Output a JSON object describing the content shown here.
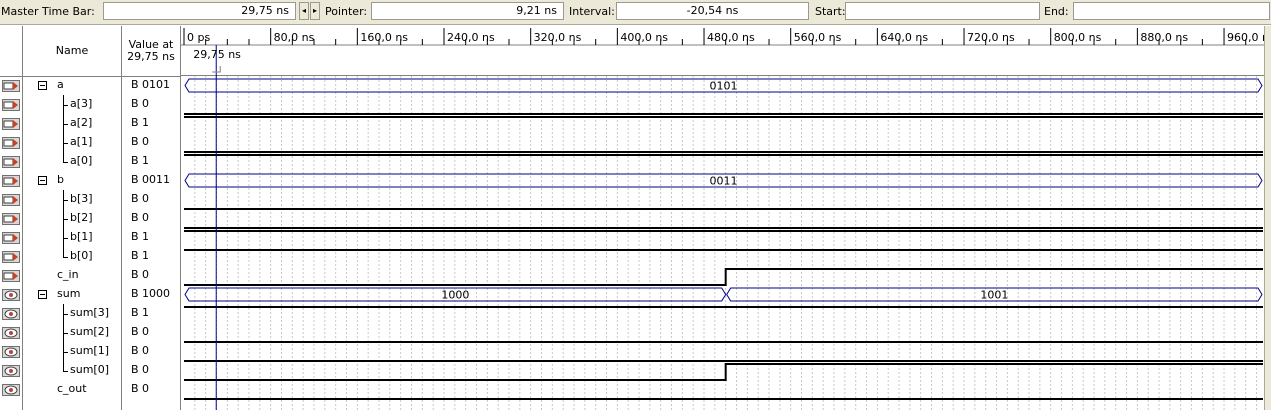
{
  "toolbar": {
    "master_time_bar_label": "Master Time Bar:",
    "master_time_bar_value": "29,75 ns",
    "pointer_label": "Pointer:",
    "pointer_value": "9,21 ns",
    "interval_label": "Interval:",
    "interval_value": "-20,54 ns",
    "start_label": "Start:",
    "start_value": "",
    "end_label": "End:",
    "end_value": "",
    "nav_left": "◂",
    "nav_right": "▸"
  },
  "columns": {
    "name_header": "Name",
    "value_header_line1": "Value at",
    "value_header_line2": "29,75 ns"
  },
  "timeline": {
    "ticks": [
      "0 ps",
      "80,0 ns",
      "160,0 ns",
      "240,0 ns",
      "320,0 ns",
      "400,0 ns",
      "480,0 ns",
      "560,0 ns",
      "640,0 ns",
      "720,0 ns",
      "800,0 ns",
      "880,0 ns",
      "960,0 ns"
    ],
    "cursor_label": "29,75 ns",
    "cursor_time_ns": 29.75,
    "ns_per_tick": 80
  },
  "signals": [
    {
      "name": "a",
      "value": "B 0101",
      "type": "input",
      "bus": true,
      "expanded": true,
      "level": 0,
      "segments": [
        {
          "from": 0,
          "to": 1000,
          "label": "0101"
        }
      ]
    },
    {
      "name": "a[3]",
      "value": "B 0",
      "type": "input",
      "level": 1,
      "tree": "mid",
      "wave": [
        [
          0,
          0
        ]
      ]
    },
    {
      "name": "a[2]",
      "value": "B 1",
      "type": "input",
      "level": 1,
      "tree": "mid",
      "wave": [
        [
          0,
          1
        ]
      ]
    },
    {
      "name": "a[1]",
      "value": "B 0",
      "type": "input",
      "level": 1,
      "tree": "mid",
      "wave": [
        [
          0,
          0
        ]
      ]
    },
    {
      "name": "a[0]",
      "value": "B 1",
      "type": "input",
      "level": 1,
      "tree": "last",
      "wave": [
        [
          0,
          1
        ]
      ]
    },
    {
      "name": "b",
      "value": "B 0011",
      "type": "input",
      "bus": true,
      "expanded": true,
      "level": 0,
      "segments": [
        {
          "from": 0,
          "to": 1000,
          "label": "0011"
        }
      ]
    },
    {
      "name": "b[3]",
      "value": "B 0",
      "type": "input",
      "level": 1,
      "tree": "mid",
      "wave": [
        [
          0,
          0
        ]
      ]
    },
    {
      "name": "b[2]",
      "value": "B 0",
      "type": "input",
      "level": 1,
      "tree": "mid",
      "wave": [
        [
          0,
          0
        ]
      ]
    },
    {
      "name": "b[1]",
      "value": "B 1",
      "type": "input",
      "level": 1,
      "tree": "mid",
      "wave": [
        [
          0,
          1
        ]
      ]
    },
    {
      "name": "b[0]",
      "value": "B 1",
      "type": "input",
      "level": 1,
      "tree": "last",
      "wave": [
        [
          0,
          1
        ]
      ]
    },
    {
      "name": "c_in",
      "value": "B 0",
      "type": "input",
      "level": 0,
      "wave": [
        [
          0,
          0
        ],
        [
          500,
          1
        ]
      ]
    },
    {
      "name": "sum",
      "value": "B 1000",
      "type": "output",
      "bus": true,
      "expanded": true,
      "level": 0,
      "segments": [
        {
          "from": 0,
          "to": 500,
          "label": "1000"
        },
        {
          "from": 500,
          "to": 1000,
          "label": "1001"
        }
      ]
    },
    {
      "name": "sum[3]",
      "value": "B 1",
      "type": "output",
      "level": 1,
      "tree": "mid",
      "wave": [
        [
          0,
          1
        ]
      ]
    },
    {
      "name": "sum[2]",
      "value": "B 0",
      "type": "output",
      "level": 1,
      "tree": "mid",
      "wave": [
        [
          0,
          0
        ]
      ]
    },
    {
      "name": "sum[1]",
      "value": "B 0",
      "type": "output",
      "level": 1,
      "tree": "mid",
      "wave": [
        [
          0,
          0
        ]
      ]
    },
    {
      "name": "sum[0]",
      "value": "B 0",
      "type": "output",
      "level": 1,
      "tree": "last",
      "wave": [
        [
          0,
          0
        ],
        [
          500,
          1
        ]
      ]
    },
    {
      "name": "c_out",
      "value": "B 0",
      "type": "output",
      "level": 0,
      "wave": [
        [
          0,
          0
        ]
      ]
    }
  ],
  "colors": {
    "cursor": "#00008b",
    "bus_outline": "#00008b",
    "wave": "#000000",
    "grid": "#c8c8c8",
    "input_icon": "#d04020",
    "output_icon": "#c0c0c0"
  },
  "icons": {
    "input": "input-pin-icon",
    "output": "output-pin-icon",
    "expander": "collapse-minus-icon"
  }
}
